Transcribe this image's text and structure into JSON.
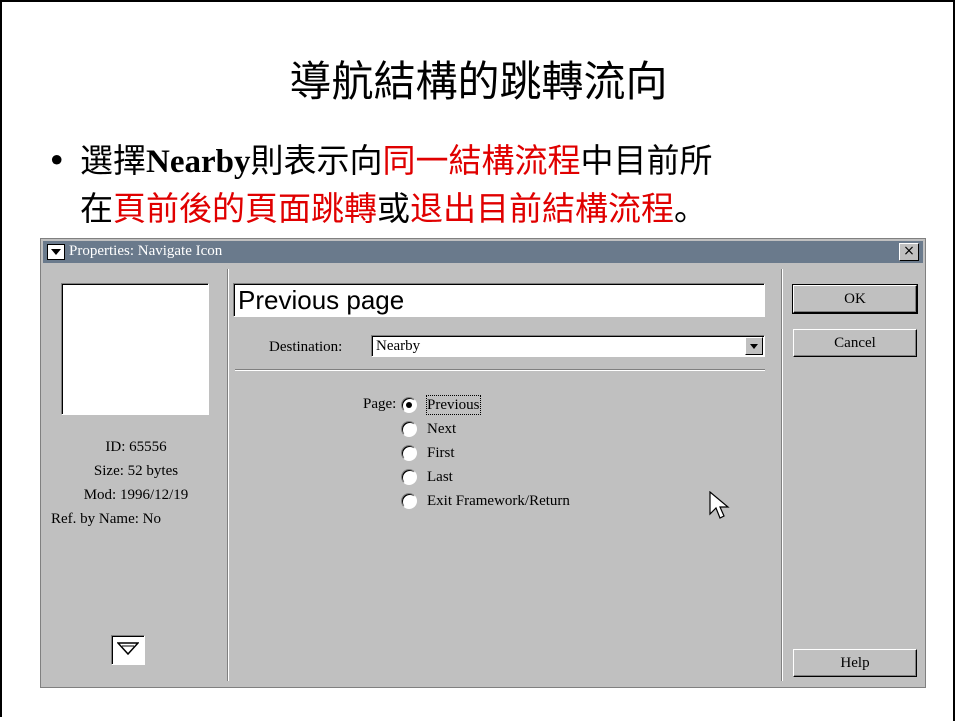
{
  "slide": {
    "title": "導航結構的跳轉流向",
    "bullet": "•",
    "line1_a": "選擇",
    "line1_bold": "Nearby",
    "line1_b": "則表示向",
    "line1_red": "同一結構流程",
    "line1_c": "中目前所",
    "line2_a": "在",
    "line2_red1": "頁前後的頁面跳轉",
    "line2_b": "或",
    "line2_red2": "退出目前結構流程",
    "line2_c": "。"
  },
  "dialog": {
    "title": "Properties: Navigate Icon",
    "close_glyph": "×",
    "info": {
      "id": "ID: 65556",
      "size": "Size: 52 bytes",
      "mod": "Mod: 1996/12/19",
      "ref": "Ref. by Name: No"
    },
    "icon_title_value": "Previous page",
    "destination_label": "Destination:",
    "destination_value": "Nearby",
    "page_label": "Page:",
    "page_options": [
      "Previous",
      "Next",
      "First",
      "Last",
      "Exit Framework/Return"
    ],
    "page_selected": "Previous",
    "buttons": {
      "ok": "OK",
      "cancel": "Cancel",
      "help": "Help"
    }
  },
  "colors": {
    "highlight_text": "#e00000",
    "titlebar": "#6a7a8c",
    "dialog_bg": "#c0c0c0"
  }
}
